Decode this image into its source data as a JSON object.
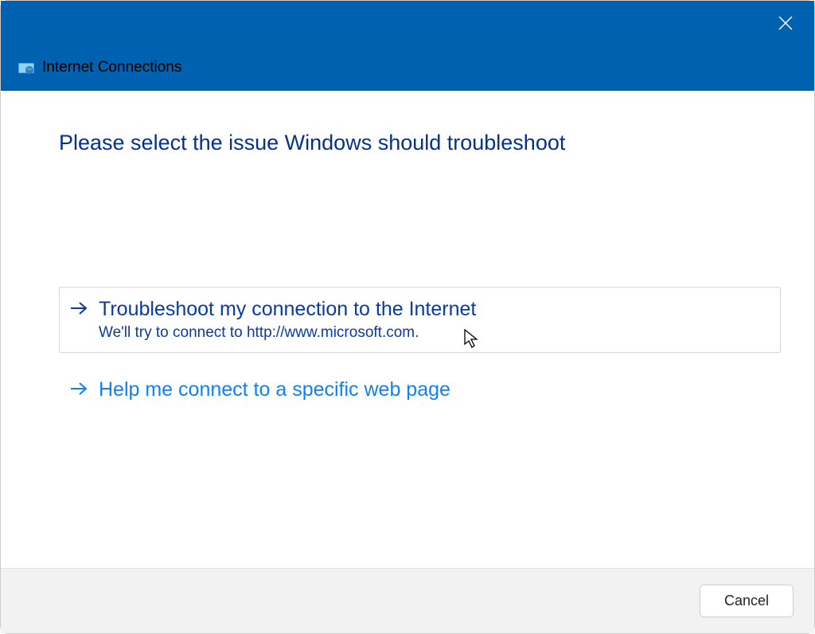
{
  "window": {
    "title": "Internet Connections"
  },
  "main": {
    "heading": "Please select the issue Windows should troubleshoot",
    "options": [
      {
        "title": "Troubleshoot my connection to the Internet",
        "subtitle": "We'll try to connect to http://www.microsoft.com."
      },
      {
        "title": "Help me connect to a specific web page"
      }
    ]
  },
  "footer": {
    "cancel_label": "Cancel"
  }
}
